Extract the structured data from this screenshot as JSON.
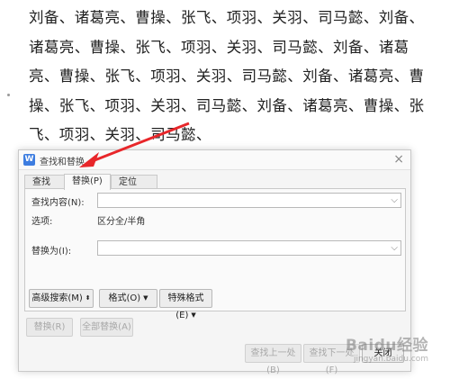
{
  "document": {
    "text": "刘备、诸葛亮、曹操、张飞、项羽、关羽、司马懿、刘备、诸葛亮、曹操、张飞、项羽、关羽、司马懿、刘备、诸葛亮、曹操、张飞、项羽、关羽、司马懿、刘备、诸葛亮、曹操、张飞、项羽、关羽、司马懿、刘备、诸葛亮、曹操、张飞、项羽、关羽、司马懿、"
  },
  "dialog": {
    "title": "查找和替换",
    "app_icon_glyph": "W",
    "close_glyph": "×",
    "tabs": [
      {
        "label": "查找(D)"
      },
      {
        "label": "替换(P)",
        "active": true
      },
      {
        "label": "定位(G)"
      }
    ],
    "find_label": "查找内容(N):",
    "find_value": "",
    "options_label": "选项:",
    "options_value": "区分全/半角",
    "replace_label": "替换为(I):",
    "replace_value": "",
    "dropdown_glyph": "⌵",
    "advanced_search_label": "高级搜索(M)",
    "format_label": "格式(O)",
    "special_format_label": "特殊格式(E)",
    "replace_button": "替换(R)",
    "replace_all_button": "全部替换(A)",
    "find_prev_button": "查找上一处(B)",
    "find_next_button": "查找下一处(F)",
    "close_button": "关闭"
  },
  "annotation": {
    "arrow_color": "#e8262a"
  },
  "watermark": {
    "text": "Baidu经验",
    "subtext": "jingyan.baidu.com"
  }
}
